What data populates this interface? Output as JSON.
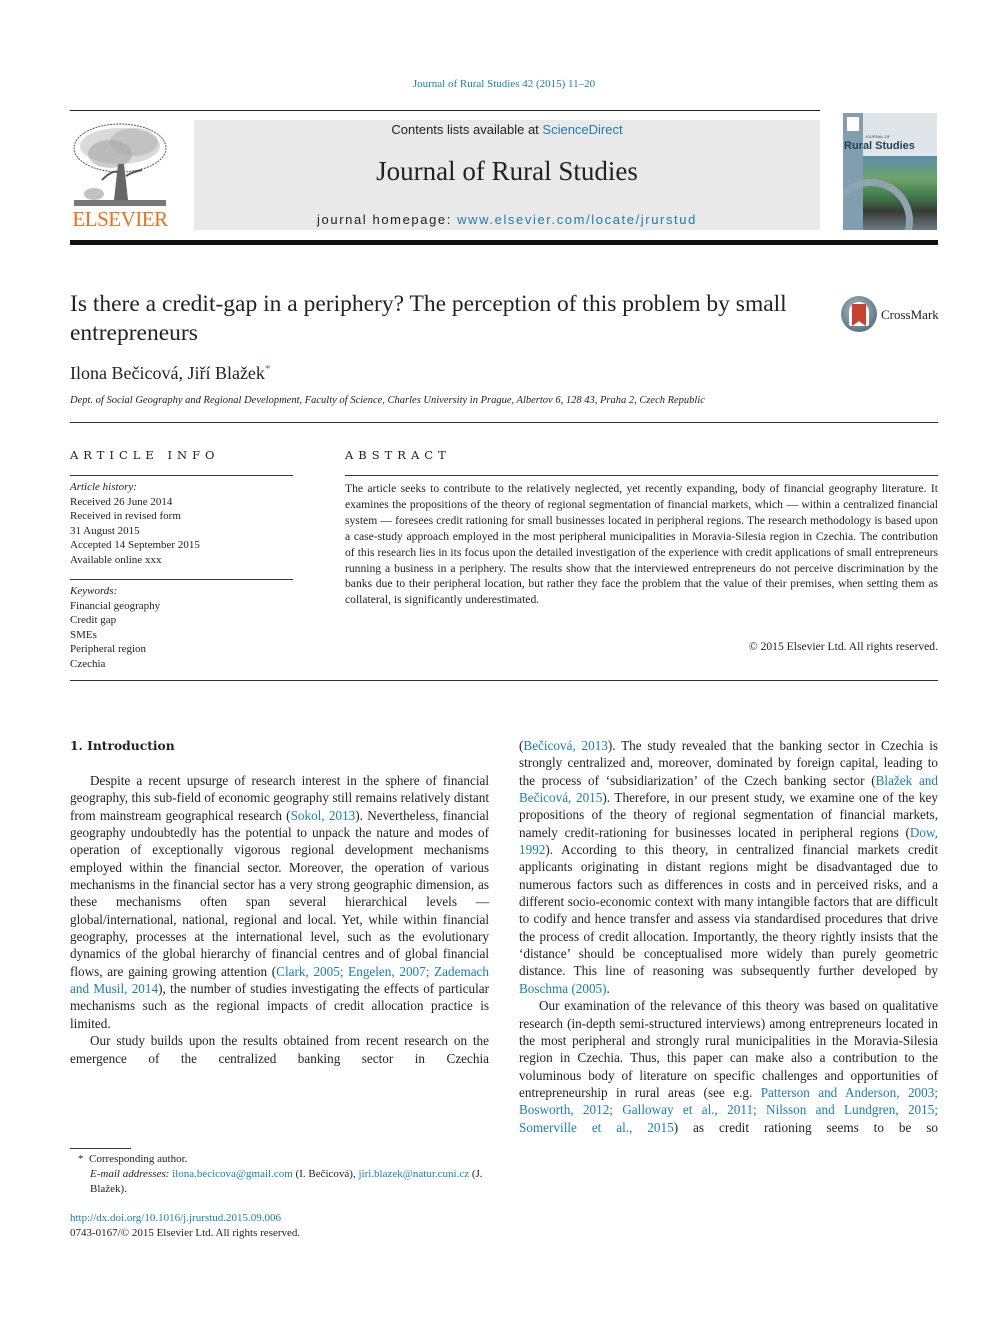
{
  "header": {
    "citation": "Journal of Rural Studies 42 (2015) 11–20",
    "contents_prefix": "Contents lists available at ",
    "contents_link": "ScienceDirect",
    "journal_name": "Journal of Rural Studies",
    "homepage_prefix": "journal homepage: ",
    "homepage_link": "www.elsevier.com/locate/jrurstud",
    "publisher_logo": "ELSEVIER",
    "cover_title": "Rural Studies",
    "cover_small": "JOURNAL OF"
  },
  "article": {
    "title": "Is there a credit-gap in a periphery? The perception of this problem by small entrepreneurs",
    "crossmark": "CrossMark",
    "authors": "Ilona Bečicová, Jiří Blažek",
    "author_marker": "*",
    "affiliation": "Dept. of Social Geography and Regional Development, Faculty of Science, Charles University in Prague, Albertov 6, 128 43, Praha 2, Czech Republic"
  },
  "article_info": {
    "heading": "ARTICLE INFO",
    "history_label": "Article history:",
    "history": [
      "Received 26 June 2014",
      "Received in revised form",
      "31 August 2015",
      "Accepted 14 September 2015",
      "Available online xxx"
    ],
    "keywords_label": "Keywords:",
    "keywords": [
      "Financial geography",
      "Credit gap",
      "SMEs",
      "Peripheral region",
      "Czechia"
    ]
  },
  "abstract": {
    "heading": "ABSTRACT",
    "text": "The article seeks to contribute to the relatively neglected, yet recently expanding, body of financial geography literature. It examines the propositions of the theory of regional segmentation of financial markets, which — within a centralized financial system — foresees credit rationing for small businesses located in peripheral regions. The research methodology is based upon a case-study approach employed in the most peripheral municipalities in Moravia-Silesia region in Czechia. The contribution of this research lies in its focus upon the detailed investigation of the experience with credit applications of small entrepreneurs running a business in a periphery. The results show that the interviewed entrepreneurs do not perceive discrimination by the banks due to their peripheral location, but rather they face the problem that the value of their premises, when setting them as collateral, is significantly underestimated.",
    "copyright": "© 2015 Elsevier Ltd. All rights reserved."
  },
  "body": {
    "section_title": "1.  Introduction",
    "left": {
      "p1_a": "Despite a recent upsurge of research interest in the sphere of financial geography, this sub-field of economic geography still remains relatively distant from mainstream geographical research (",
      "p1_link1": "Sokol, 2013",
      "p1_b": "). Nevertheless, financial geography undoubtedly has the potential to unpack the nature and modes of operation of exceptionally vigorous regional development mechanisms employed within the financial sector. Moreover, the operation of various mechanisms in the financial sector has a very strong geographic dimension, as these mechanisms often span several hierarchical levels — global/international, national, regional and local. Yet, while within financial geography, processes at the international level, such as the evolutionary dynamics of the global hierarchy of financial centres and of global financial flows, are gaining growing attention (",
      "p1_link2": "Clark, 2005; Engelen, 2007; Zademach and Musil, 2014",
      "p1_c": "), the number of studies investigating the effects of particular mechanisms such as the regional impacts of credit allocation practice is limited.",
      "p2": "Our study builds upon the results obtained from recent research on the emergence of the centralized banking sector in Czechia"
    },
    "right": {
      "p2_link1": "Bečicová, 2013",
      "p2_a": "). The study revealed that the banking sector in Czechia is strongly centralized and, moreover, dominated by foreign capital, leading to the process of ‘subsidiarization’ of the Czech banking sector (",
      "p2_link2": "Blažek and Bečicová, 2015",
      "p2_b": "). Therefore, in our present study, we examine one of the key propositions of the theory of regional segmentation of financial markets, namely credit-rationing for businesses located in peripheral regions (",
      "p2_link3": "Dow, 1992",
      "p2_c": "). According to this theory, in centralized financial markets credit applicants originating in distant regions might be disadvantaged due to numerous factors such as differences in costs and in perceived risks, and a different socio-economic context with many intangible factors that are difficult to codify and hence transfer and assess via standardised procedures that drive the process of credit allocation. Importantly, the theory rightly insists that the ‘distance’ should be conceptualised more widely than purely geometric distance. This line of reasoning was subsequently further developed by ",
      "p2_link4": "Boschma (2005)",
      "p2_d": ".",
      "p3_a": "Our examination of the relevance of this theory was based on qualitative research (in-depth semi-structured interviews) among entrepreneurs located in the most peripheral and strongly rural municipalities in the Moravia-Silesia region in Czechia. Thus, this paper can make also a contribution to the voluminous body of literature on specific challenges and opportunities of entrepreneurship in rural areas (see e.g. ",
      "p3_link": "Patterson and Anderson, 2003; Bosworth, 2012; Galloway et al., 2011; Nilsson and Lundgren, 2015; Somerville et al., 2015",
      "p3_b": ") as credit rationing seems to be so"
    }
  },
  "footnote": {
    "marker": "*",
    "corresponding": "Corresponding author.",
    "email_label": "E-mail addresses:",
    "email1": "ilona.becicova@gmail.com",
    "email1_name": " (I. Bečicová), ",
    "email2": "jiri.blazek@natur.cuni.cz",
    "email2_name": " (J. Blažek)."
  },
  "doi": {
    "link": "http://dx.doi.org/10.1016/j.jrurstud.2015.09.006",
    "issn": "0743-0167/© 2015 Elsevier Ltd. All rights reserved."
  },
  "colors": {
    "link": "#1a7fae",
    "elsevier_orange": "#e9711c",
    "banner_bg": "#e9e9e9"
  }
}
